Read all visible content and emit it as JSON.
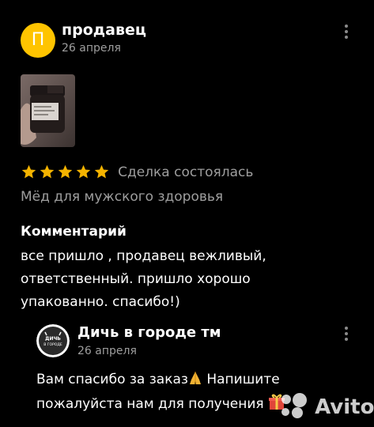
{
  "review": {
    "author_initial": "П",
    "author_name": "продавец",
    "date": "26 апреля",
    "rating": 5,
    "rating_max": 5,
    "deal_status": "Сделка состоялась",
    "product": "Мёд для мужского здоровья",
    "comment_heading": "Комментарий",
    "comment_lines": [
      "все пришло , продавец вежливый,",
      "ответственный. пришло хорошо",
      "упакованно. спасибо!)"
    ]
  },
  "reply": {
    "author_name": "Дичь в городе тм",
    "logo_text": "ДИЧЬ В ГОРОДЕ",
    "date": "26 апреля",
    "line1": "Вам спасибо за заказ",
    "line1_rest": " Напишите",
    "line2": "пожалуйста нам для получения"
  },
  "watermark": {
    "brand": "Avito"
  },
  "colors": {
    "background": "#000000",
    "avatar": "#ffc400",
    "star": "#f5b400",
    "muted_text": "#9e9e9e",
    "text": "#ffffff"
  },
  "icons": {
    "more": "more-vertical-icon",
    "star": "star-icon",
    "pray": "folded-hands-emoji",
    "gift": "gift-emoji"
  }
}
